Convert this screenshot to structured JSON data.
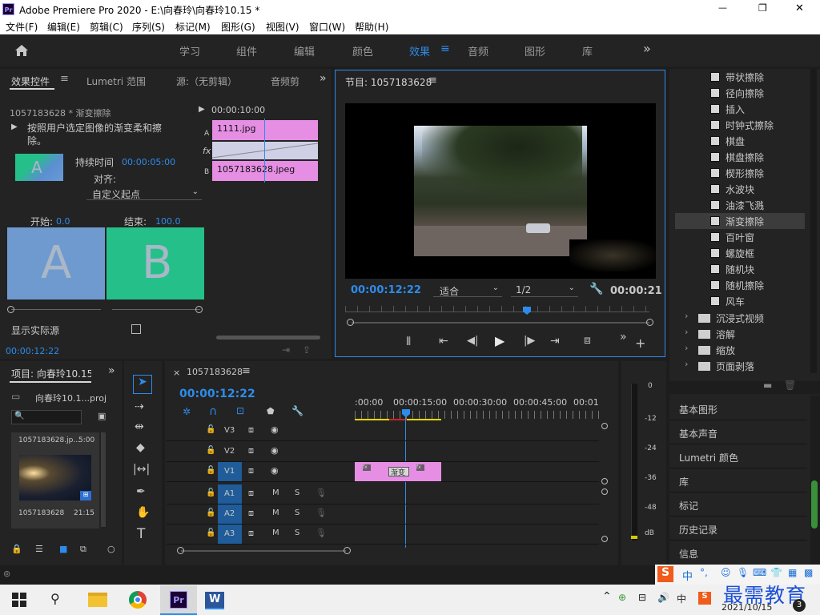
{
  "window": {
    "title": "Adobe Premiere Pro 2020 - E:\\向春玲\\向春玲10.15 *",
    "logo": "Pr",
    "minimize": "—",
    "maximize": "❐",
    "close": "✕"
  },
  "menu": [
    "文件(F)",
    "编辑(E)",
    "剪辑(C)",
    "序列(S)",
    "标记(M)",
    "图形(G)",
    "视图(V)",
    "窗口(W)",
    "帮助(H)"
  ],
  "workspaces": {
    "items": [
      "学习",
      "组件",
      "编辑",
      "颜色",
      "效果",
      "音频",
      "图形",
      "库"
    ],
    "active": "效果",
    "more": "»"
  },
  "effect_controls": {
    "tabs": [
      "效果控件",
      "Lumetri 范围",
      "源:（无剪辑）",
      "音频剪"
    ],
    "more": "»",
    "clip_name": "1057183628 * 渐变擦除",
    "timecode": "00:00:10:00",
    "description": "按照用户选定图像的渐变柔和擦除。",
    "duration_label": "持续时间",
    "duration": "00:00:05:00",
    "align_label": "对齐:",
    "align_value": "自定义起点",
    "start_label": "开始:",
    "start_value": "0.0",
    "end_label": "结束:",
    "end_value": "100.0",
    "letter_a": "A",
    "letter_b": "B",
    "show_source": "显示实际源",
    "track_a_label": "A",
    "track_b_label": "B",
    "fx_label": "fx",
    "clip_a": "1111.jpg",
    "clip_b": "1057183628.jpeg",
    "footer_timecode": "00:00:12:22"
  },
  "program": {
    "title": "节目: 1057183628",
    "timecode": "00:00:12:22",
    "fit": "适合",
    "resolution": "1/2",
    "duration": "00:00:21"
  },
  "effects_list": {
    "items": [
      "带状擦除",
      "径向擦除",
      "插入",
      "时钟式擦除",
      "棋盘",
      "棋盘擦除",
      "楔形擦除",
      "水波块",
      "油漆飞溅",
      "渐变擦除",
      "百叶窗",
      "螺旋框",
      "随机块",
      "随机擦除",
      "风车"
    ],
    "selected": "渐变擦除",
    "folders": [
      "沉浸式视频",
      "溶解",
      "缩放",
      "页面剥落"
    ]
  },
  "right_panels": [
    "基本图形",
    "基本声音",
    "Lumetri 颜色",
    "库",
    "标记",
    "历史记录",
    "信息"
  ],
  "project": {
    "title": "项目: 向春玲10.15",
    "file": "向春玲10.1...proj",
    "clip_top": "1057183628.jp...",
    "clip_top_dur": "5:00",
    "clip_name": "1057183628",
    "clip_dur": "21:15"
  },
  "timeline": {
    "title": "1057183628",
    "timecode": "00:00:12:22",
    "ruler": [
      ":00:00",
      "00:00:15:00",
      "00:00:30:00",
      "00:00:45:00",
      "00:01:0"
    ],
    "video_tracks": [
      "V3",
      "V2",
      "V1"
    ],
    "audio_tracks": [
      "A1",
      "A2",
      "A3"
    ],
    "m": "M",
    "s": "S",
    "transition_label": "渐变"
  },
  "meter": {
    "labels": [
      "0",
      "-12",
      "-24",
      "-36",
      "-48",
      "dB"
    ]
  },
  "ime": {
    "items": [
      "中",
      "°,"
    ]
  },
  "watermark": "最需教育",
  "taskbar": {
    "date": "2021/10/15",
    "word": "W",
    "pr": "Pr",
    "badge": "3"
  }
}
